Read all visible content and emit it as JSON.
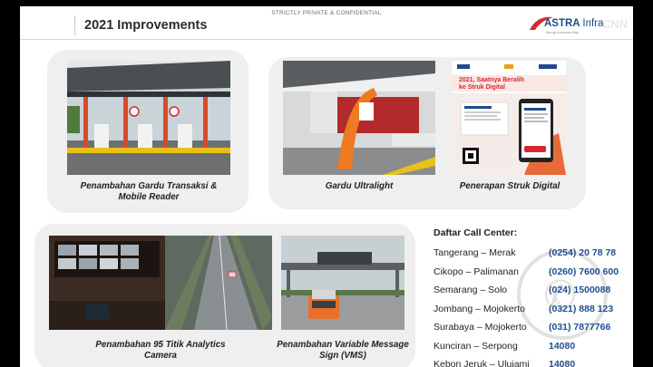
{
  "header": {
    "confidential": "STRICTLY PRIVATE & CONFIDENTIAL",
    "title": "2021 Improvements",
    "logo_brand": "ASTRA",
    "logo_suffix": "Infra",
    "logo_tagline": "Menuju Indonesia Maju"
  },
  "sections": {
    "gardu_transaksi": {
      "caption": "Penambahan Gardu Transaksi & Mobile Reader"
    },
    "gardu_ultralight": {
      "caption": "Gardu Ultralight"
    },
    "struk_digital": {
      "caption": "Penerapan Struk Digital",
      "poster_heading_1": "2021, Saatnya Beralih",
      "poster_heading_2": "ke Struk Digital"
    },
    "analytics_camera": {
      "caption": "Penambahan 95 Titik Analytics Camera"
    },
    "vms": {
      "caption": "Penambahan Variable Message Sign (VMS)"
    }
  },
  "call_center": {
    "title": "Daftar Call Center:",
    "rows": [
      {
        "city": "Tangerang – Merak",
        "number": "(0254) 20 78 78"
      },
      {
        "city": "Cikopo – Palimanan",
        "number": "(0260) 7600 600"
      },
      {
        "city": "Semarang – Solo",
        "number": "(024) 1500088"
      },
      {
        "city": "Jombang – Mojokerto",
        "number": "(0321) 888 123"
      },
      {
        "city": "Surabaya – Mojokerto",
        "number": "(031) 7877766"
      },
      {
        "city": "Kunciran – Serpong",
        "number": "14080"
      },
      {
        "city": "Kebon Jeruk – Ulujami",
        "number": "14080"
      }
    ]
  },
  "overlay": {
    "corner_mark": "CNN"
  },
  "colors": {
    "accent_red": "#d8262f",
    "number_blue": "#1f4e8e",
    "panel_bg": "#efefef",
    "vms_truck": "#e8702a"
  },
  "icons": {
    "logo": "astra-swoosh-icon",
    "watermark": "phone-circle-icon"
  }
}
